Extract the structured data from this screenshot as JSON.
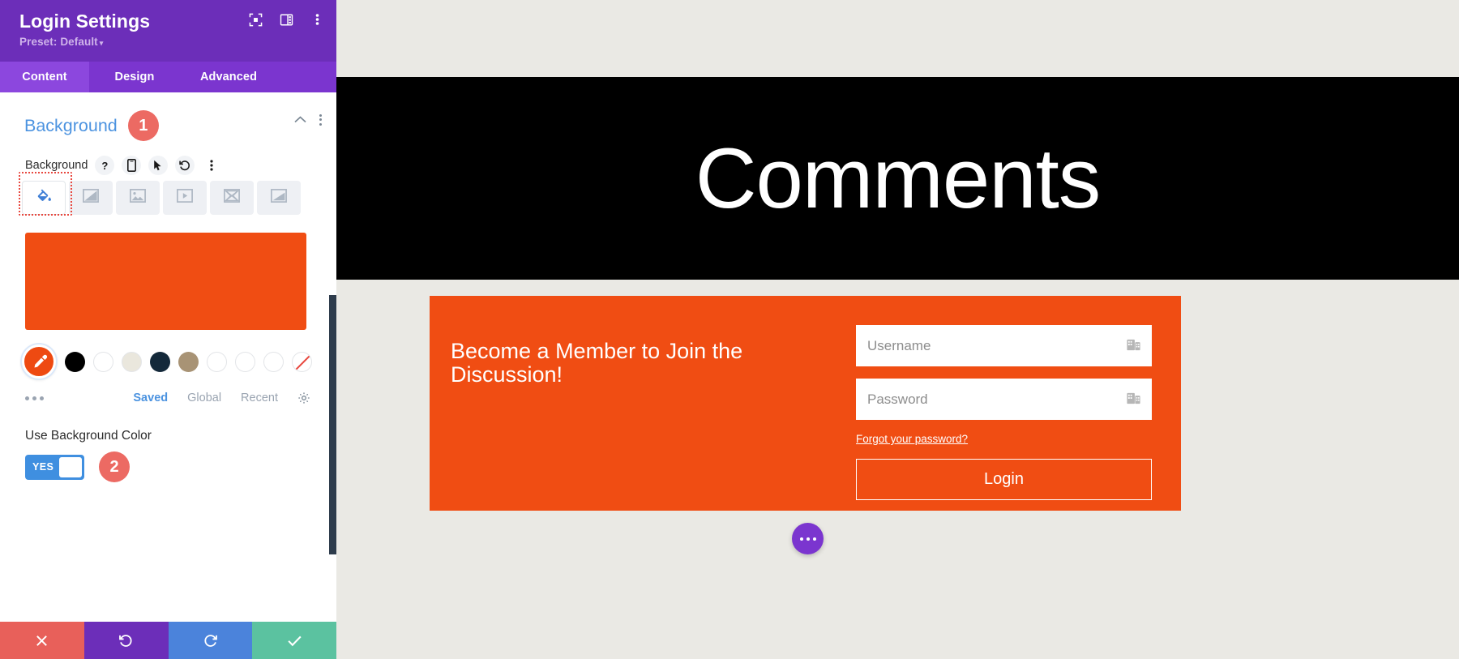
{
  "panel": {
    "title": "Login Settings",
    "preset": "Preset: Default",
    "preset_caret": "▾",
    "header_icons": [
      {
        "name": "fullscreen-icon"
      },
      {
        "name": "layout-columns-icon"
      },
      {
        "name": "kebab-menu-icon"
      }
    ],
    "tabs": [
      {
        "label": "Content",
        "active": true
      },
      {
        "label": "Design",
        "active": false
      },
      {
        "label": "Advanced",
        "active": false
      }
    ],
    "section": {
      "title": "Background",
      "badge": "1",
      "collapse_icon": "chevron-up-icon",
      "menu_icon": "kebab-menu-icon"
    },
    "field": {
      "label": "Background",
      "tools": [
        {
          "name": "help-icon",
          "glyph": "?"
        },
        {
          "name": "responsive-mobile-icon"
        },
        {
          "name": "hover-cursor-icon"
        },
        {
          "name": "reset-undo-icon"
        },
        {
          "name": "kebab-menu-icon"
        }
      ]
    },
    "bg_types": [
      {
        "name": "background-color-tab",
        "icon": "paint-bucket-icon",
        "active": true
      },
      {
        "name": "background-gradient-tab",
        "icon": "gradient-icon",
        "active": false
      },
      {
        "name": "background-image-tab",
        "icon": "image-icon",
        "active": false
      },
      {
        "name": "background-video-tab",
        "icon": "video-icon",
        "active": false
      },
      {
        "name": "background-pattern-tab",
        "icon": "pattern-icon",
        "active": false
      },
      {
        "name": "background-mask-tab",
        "icon": "mask-icon",
        "active": false
      }
    ],
    "color_preview": "#f04d13",
    "eyedropper": {
      "name": "eyedropper-icon",
      "color": "#ee4a12"
    },
    "swatches": [
      {
        "color": "#000000",
        "bordered": false
      },
      {
        "color": "#ffffff",
        "bordered": true
      },
      {
        "color": "#eae7dd",
        "bordered": true
      },
      {
        "color": "#14293a",
        "bordered": false
      },
      {
        "color": "#a89375",
        "bordered": false
      },
      {
        "color": "#ffffff",
        "bordered": true
      },
      {
        "color": "#ffffff",
        "bordered": true
      },
      {
        "color": "#ffffff",
        "bordered": true
      },
      {
        "color": "none",
        "bordered": true
      }
    ],
    "palette_links": [
      {
        "label": "Saved",
        "active": true
      },
      {
        "label": "Global",
        "active": false
      },
      {
        "label": "Recent",
        "active": false
      }
    ],
    "palette_settings_icon": "gear-icon",
    "more_dots_icon": "more-dots-icon",
    "toggle": {
      "label": "Use Background Color",
      "value": "YES",
      "badge": "2",
      "accent": "#3f8fe0"
    },
    "actions": [
      {
        "name": "discard-changes-button",
        "icon": "close-x-icon",
        "color": "#e8605a"
      },
      {
        "name": "undo-button",
        "icon": "undo-icon",
        "color": "#6c2eb9"
      },
      {
        "name": "redo-button",
        "icon": "redo-icon",
        "color": "#4b83db"
      },
      {
        "name": "save-changes-button",
        "icon": "checkmark-icon",
        "color": "#5bc2a0"
      }
    ]
  },
  "preview": {
    "hero_title": "Comments",
    "login": {
      "heading": "Become a Member to Join the Discussion!",
      "username_placeholder": "Username",
      "password_placeholder": "Password",
      "forgot_label": "Forgot your password?",
      "submit_label": "Login",
      "background": "#f04d13"
    },
    "fab": {
      "name": "page-settings-fab",
      "icon": "ellipsis-icon"
    }
  }
}
